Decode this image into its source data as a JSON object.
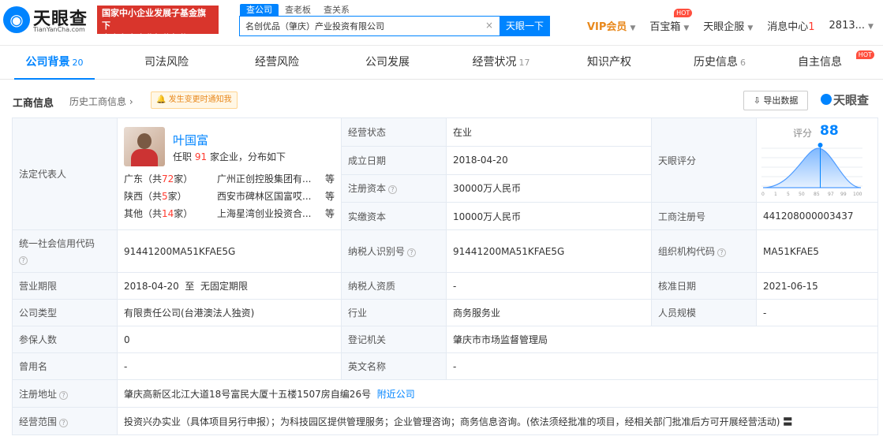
{
  "header": {
    "logo_text": "天眼查",
    "logo_sub": "TianYanCha.com",
    "gov_badge_line1": "国家中小企业发展子基金旗下",
    "gov_badge_line2": "官方备案企业征信机构",
    "search_tabs": [
      "查公司",
      "查老板",
      "查关系"
    ],
    "search_value": "名创优品（肇庆）产业投资有限公司",
    "search_button": "天眼一下",
    "vip": "VIP会员",
    "baobao": "百宝箱",
    "hot": "HOT",
    "enterprise": "天眼企服",
    "message_label": "消息中心",
    "message_count": "1",
    "user": "2813..."
  },
  "tabs": [
    {
      "label": "公司背景",
      "count": "20"
    },
    {
      "label": "司法风险",
      "count": ""
    },
    {
      "label": "经营风险",
      "count": ""
    },
    {
      "label": "公司发展",
      "count": ""
    },
    {
      "label": "经营状况",
      "count": "17"
    },
    {
      "label": "知识产权",
      "count": ""
    },
    {
      "label": "历史信息",
      "count": "6"
    },
    {
      "label": "自主信息",
      "count": ""
    }
  ],
  "subheader": {
    "title": "工商信息",
    "history": "历史工商信息",
    "notify": "发生变更时通知我",
    "export": "导出数据",
    "watermark": "天眼查"
  },
  "legal": {
    "label": "法定代表人",
    "name": "叶国富",
    "sub_prefix": "任职",
    "sub_count": "91",
    "sub_suffix": "家企业，分布如下",
    "regions": [
      {
        "prov_prefix": "广东（共",
        "count": "72",
        "prov_suffix": "家）",
        "company": "广州正创控股集团有...",
        "more": "等"
      },
      {
        "prov_prefix": "陕西（共",
        "count": "5",
        "prov_suffix": "家）",
        "company": "西安市碑林区国富哎...",
        "more": "等"
      },
      {
        "prov_prefix": "其他（共",
        "count": "14",
        "prov_suffix": "家）",
        "company": "上海星湾创业投资合...",
        "more": "等"
      }
    ]
  },
  "score": {
    "row_label": "天眼评分",
    "label": "评分",
    "value": "88",
    "value_num": 88,
    "axis": [
      "0",
      "1",
      "5",
      "50",
      "85",
      "97",
      "99",
      "100"
    ]
  },
  "fields": {
    "status_label": "经营状态",
    "status": "在业",
    "founded_label": "成立日期",
    "founded": "2018-04-20",
    "reg_capital_label": "注册资本",
    "reg_capital": "30000万人民币",
    "paid_capital_label": "实缴资本",
    "paid_capital": "10000万人民币",
    "reg_no_label": "工商注册号",
    "reg_no": "441208000003437",
    "credit_code_label": "统一社会信用代码",
    "credit_code": "91441200MA51KFAE5G",
    "tax_id_label": "纳税人识别号",
    "tax_id": "91441200MA51KFAE5G",
    "org_code_label": "组织机构代码",
    "org_code": "MA51KFAE5",
    "term_label": "营业期限",
    "term": "2018-04-20  至  无固定期限",
    "taxpayer_label": "纳税人资质",
    "taxpayer": "-",
    "approved_label": "核准日期",
    "approved": "2021-06-15",
    "type_label": "公司类型",
    "type": "有限责任公司(台港澳法人独资)",
    "industry_label": "行业",
    "industry": "商务服务业",
    "staff_label": "人员规模",
    "staff": "-",
    "insured_label": "参保人数",
    "insured": "0",
    "authority_label": "登记机关",
    "authority": "肇庆市市场监督管理局",
    "former_label": "曾用名",
    "former": "-",
    "english_label": "英文名称",
    "english": "-",
    "address_label": "注册地址",
    "address": "肇庆高新区北江大道18号富民大厦十五楼1507房自编26号",
    "nearby": "附近公司",
    "scope_label": "经营范围",
    "scope": "投资兴办实业（具体项目另行申报）；为科技园区提供管理服务；企业管理咨询；商务信息咨询。(依法须经批准的项目，经相关部门批准后方可开展经营活动)"
  }
}
